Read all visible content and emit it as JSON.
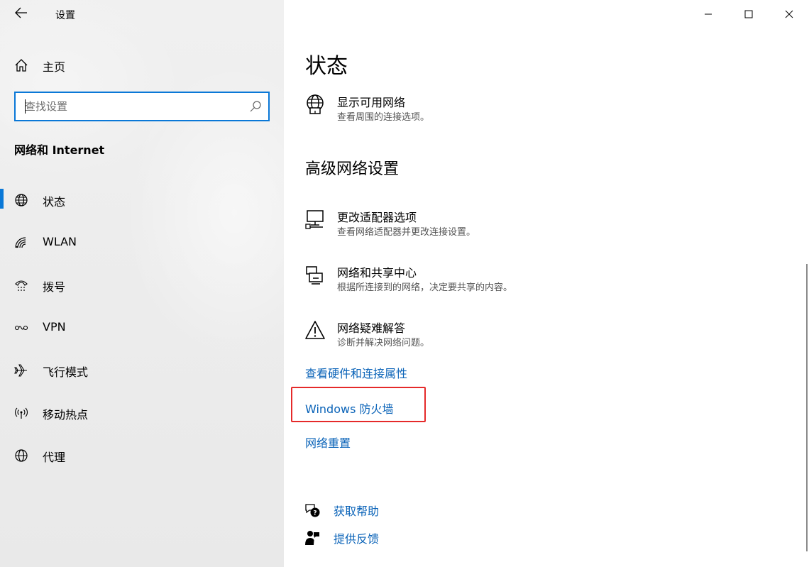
{
  "sidebar": {
    "app_title": "设置",
    "home_label": "主页",
    "search_placeholder": "查找设置",
    "section_title": "网络和 Internet",
    "items": [
      {
        "label": "状态",
        "icon": "globe-icon",
        "active": true
      },
      {
        "label": "WLAN",
        "icon": "wifi-icon"
      },
      {
        "label": "拨号",
        "icon": "dialup-icon"
      },
      {
        "label": "VPN",
        "icon": "vpn-icon"
      },
      {
        "label": "飞行模式",
        "icon": "airplane-icon"
      },
      {
        "label": "移动热点",
        "icon": "hotspot-icon"
      },
      {
        "label": "代理",
        "icon": "globe-icon"
      }
    ]
  },
  "main": {
    "title": "状态",
    "show_networks": {
      "title": "显示可用网络",
      "desc": "查看周围的连接选项。"
    },
    "advanced_heading": "高级网络设置",
    "adapter_options": {
      "title": "更改适配器选项",
      "desc": "查看网络适配器并更改连接设置。"
    },
    "sharing_center": {
      "title": "网络和共享中心",
      "desc": "根据所连接到的网络，决定要共享的内容。"
    },
    "troubleshooter": {
      "title": "网络疑难解答",
      "desc": "诊断并解决网络问题。"
    },
    "links": {
      "hardware_properties": "查看硬件和连接属性",
      "firewall": "Windows 防火墙",
      "network_reset": "网络重置"
    },
    "help": {
      "get_help": "获取帮助",
      "feedback": "提供反馈"
    }
  },
  "colors": {
    "accent": "#0a78d7",
    "link": "#0a63b8",
    "highlight_box": "#e52a2a"
  }
}
